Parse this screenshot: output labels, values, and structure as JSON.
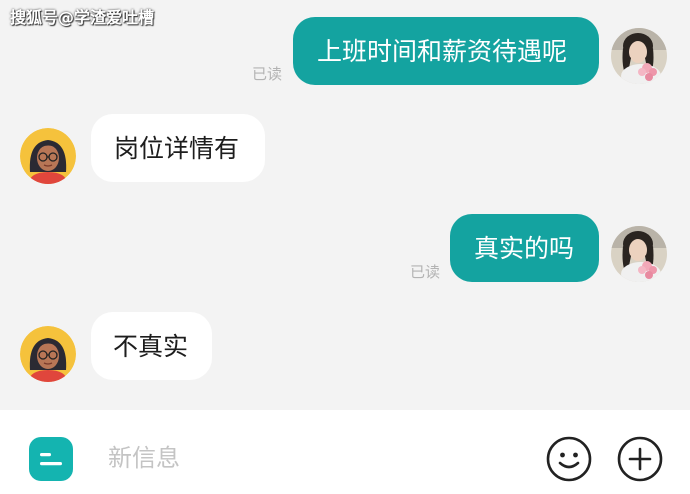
{
  "watermark": "搜狐号@学渣爱吐槽",
  "messages": [
    {
      "side": "out",
      "text": "上班时间和薪资待遇呢",
      "status": "已读"
    },
    {
      "side": "in",
      "text": "岗位详情有"
    },
    {
      "side": "out",
      "text": "真实的吗",
      "status": "已读"
    },
    {
      "side": "in",
      "text": "不真实"
    }
  ],
  "composer": {
    "placeholder": "新信息",
    "value": ""
  },
  "icons": {
    "app": "app-menu-icon",
    "emoji": "smiley-icon",
    "add": "plus-icon"
  },
  "colors": {
    "outgoing_bubble": "#14a3a0",
    "incoming_bubble": "#ffffff",
    "background": "#f3f3f3"
  }
}
